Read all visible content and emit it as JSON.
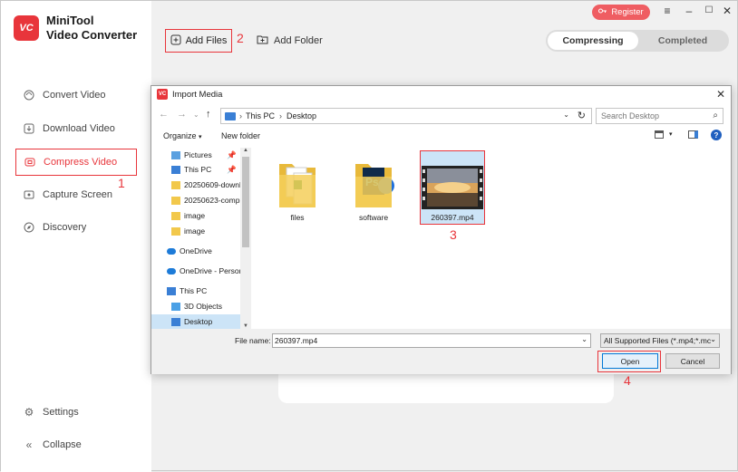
{
  "app": {
    "logo_text": "VC",
    "brand_line1": "MiniTool",
    "brand_line2": "Video Converter",
    "accent": "#e8353b"
  },
  "sidebar": {
    "items": [
      {
        "label": "Convert Video",
        "icon": "convert-icon"
      },
      {
        "label": "Download Video",
        "icon": "download-icon"
      },
      {
        "label": "Compress Video",
        "icon": "compress-icon",
        "active": true
      },
      {
        "label": "Capture Screen",
        "icon": "capture-icon"
      },
      {
        "label": "Discovery",
        "icon": "discovery-icon"
      }
    ],
    "settings": "Settings",
    "collapse": "Collapse"
  },
  "header": {
    "register": "Register",
    "add_files": "Add Files",
    "add_folder": "Add Folder",
    "tab_compressing": "Compressing",
    "tab_completed": "Completed"
  },
  "annotations": {
    "n1": "1",
    "n2": "2",
    "n3": "3",
    "n4": "4"
  },
  "dialog": {
    "title": "Import Media",
    "breadcrumb_1": "This PC",
    "breadcrumb_2": "Desktop",
    "search_placeholder": "Search Desktop",
    "organize": "Organize",
    "new_folder": "New folder",
    "tree": [
      "Pictures",
      "This PC",
      "20250609-downl",
      "20250623-compr",
      "image",
      "image",
      "OneDrive",
      "OneDrive - Person",
      "This PC",
      "3D Objects",
      "Desktop"
    ],
    "files": [
      {
        "name": "files"
      },
      {
        "name": "software"
      },
      {
        "name": "260397.mp4",
        "selected": true
      }
    ],
    "file_name_label": "File name:",
    "file_name_value": "260397.mp4",
    "file_type": "All Supported Files (*.mp4;*.mc",
    "open": "Open",
    "cancel": "Cancel"
  }
}
